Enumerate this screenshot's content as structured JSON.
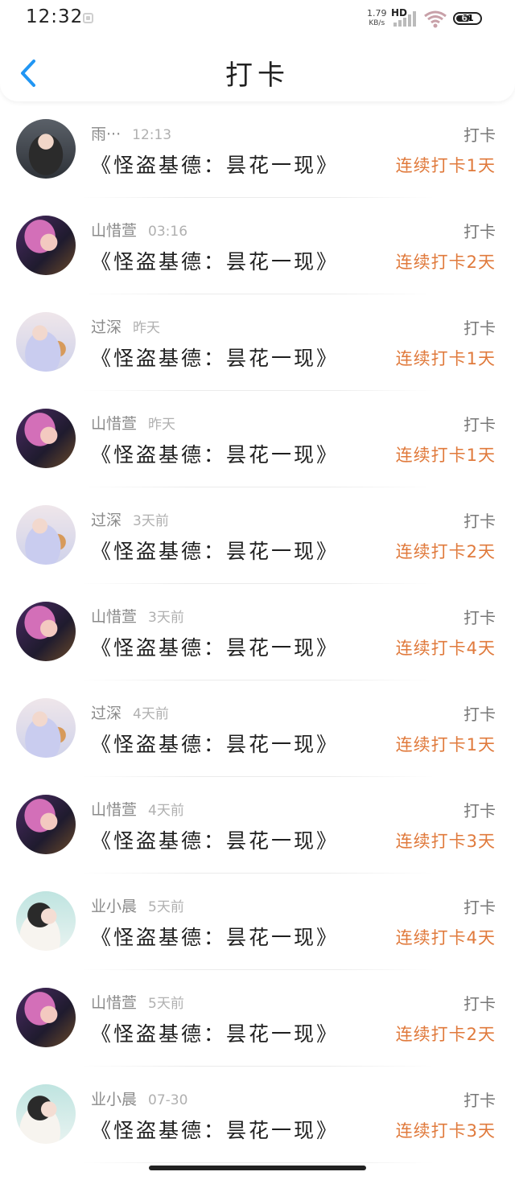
{
  "status_bar": {
    "time": "12:32",
    "speed_value": "1.79",
    "speed_unit": "KB/s",
    "network": "HD",
    "battery": "61",
    "battery_level": 0.61
  },
  "header": {
    "title": "打卡",
    "back_icon": "chevron-left-icon"
  },
  "colors": {
    "accent": "#2196f3",
    "streak": "#e07a3c"
  },
  "items": [
    {
      "user": "雨···",
      "time": "12:13",
      "book": "《怪盗基德：昙花一现》",
      "action": "打卡",
      "streak": "连续打卡1天",
      "avatar": "a"
    },
    {
      "user": "山惜萱",
      "time": "03:16",
      "book": "《怪盗基德：昙花一现》",
      "action": "打卡",
      "streak": "连续打卡2天",
      "avatar": "b"
    },
    {
      "user": "过深",
      "time": "昨天",
      "book": "《怪盗基德：昙花一现》",
      "action": "打卡",
      "streak": "连续打卡1天",
      "avatar": "c"
    },
    {
      "user": "山惜萱",
      "time": "昨天",
      "book": "《怪盗基德：昙花一现》",
      "action": "打卡",
      "streak": "连续打卡1天",
      "avatar": "b"
    },
    {
      "user": "过深",
      "time": "3天前",
      "book": "《怪盗基德：昙花一现》",
      "action": "打卡",
      "streak": "连续打卡2天",
      "avatar": "c"
    },
    {
      "user": "山惜萱",
      "time": "3天前",
      "book": "《怪盗基德：昙花一现》",
      "action": "打卡",
      "streak": "连续打卡4天",
      "avatar": "b"
    },
    {
      "user": "过深",
      "time": "4天前",
      "book": "《怪盗基德：昙花一现》",
      "action": "打卡",
      "streak": "连续打卡1天",
      "avatar": "c"
    },
    {
      "user": "山惜萱",
      "time": "4天前",
      "book": "《怪盗基德：昙花一现》",
      "action": "打卡",
      "streak": "连续打卡3天",
      "avatar": "b"
    },
    {
      "user": "业小晨",
      "time": "5天前",
      "book": "《怪盗基德：昙花一现》",
      "action": "打卡",
      "streak": "连续打卡4天",
      "avatar": "d"
    },
    {
      "user": "山惜萱",
      "time": "5天前",
      "book": "《怪盗基德：昙花一现》",
      "action": "打卡",
      "streak": "连续打卡2天",
      "avatar": "b"
    },
    {
      "user": "业小晨",
      "time": "07-30",
      "book": "《怪盗基德：昙花一现》",
      "action": "打卡",
      "streak": "连续打卡3天",
      "avatar": "d"
    }
  ]
}
